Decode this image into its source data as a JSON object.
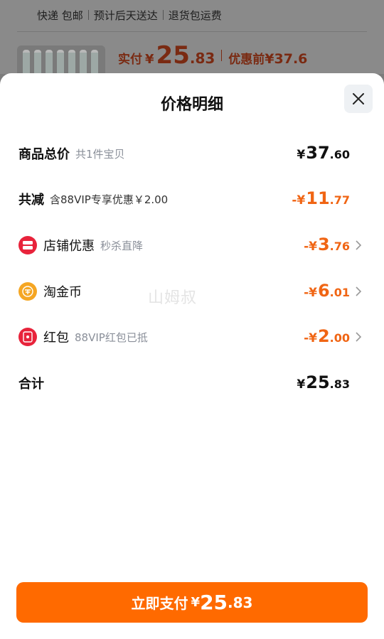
{
  "background": {
    "tags": [
      "快递 包邮",
      "预计后天送达",
      "退货包运费"
    ],
    "price_label": "实付",
    "price_yen": "¥",
    "price_int": "25",
    "price_dec": ".83",
    "before_label": "优惠前",
    "before_value": "¥37.6"
  },
  "sheet": {
    "title": "价格明细",
    "close_icon": "close-icon"
  },
  "rows": {
    "total_goods": {
      "label": "商品总价",
      "sub": "共1件宝贝",
      "yen": "¥",
      "int": "37",
      "dec": ".60"
    },
    "reduction": {
      "label": "共减",
      "sub": "含88VIP专享优惠￥2.00",
      "yen": "-¥",
      "int": "11",
      "dec": ".77"
    },
    "shop_discount": {
      "label": "店铺优惠",
      "sub": "秒杀直降",
      "yen": "-¥",
      "int": "3",
      "dec": ".76",
      "icon": "shop-coupon-icon"
    },
    "taojinbi": {
      "label": "淘金币",
      "sub": "",
      "yen": "-¥",
      "int": "6",
      "dec": ".01",
      "icon": "gold-coin-icon"
    },
    "red_packet": {
      "label": "红包",
      "sub": "88VIP红包已抵",
      "yen": "-¥",
      "int": "2",
      "dec": ".00",
      "icon": "red-packet-icon"
    },
    "sum": {
      "label": "合计",
      "yen": "¥",
      "int": "25",
      "dec": ".83"
    }
  },
  "watermark": "山姆叔",
  "pay_button": {
    "label": "立即支付",
    "yen": "¥",
    "int": "25",
    "dec": ".83"
  },
  "colors": {
    "accent_orange": "#ff6a00",
    "discount_orange": "#f06514",
    "red_icon": "#e8233b",
    "gold_icon": "#f5a623"
  }
}
